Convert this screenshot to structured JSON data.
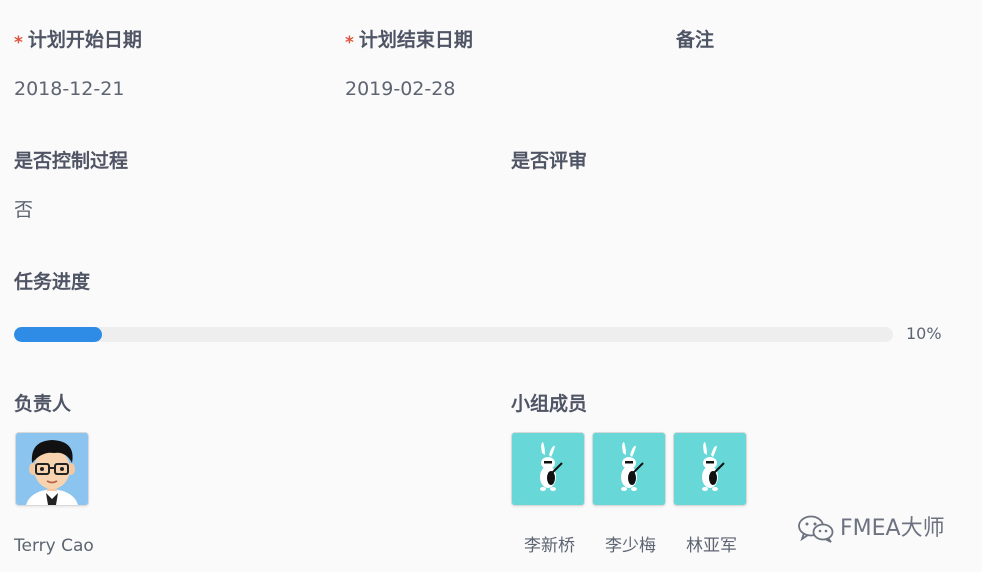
{
  "fields": {
    "plan_start_label": "计划开始日期",
    "plan_start_value": "2018-12-21",
    "plan_end_label": "计划结束日期",
    "plan_end_value": "2019-02-28",
    "remarks_label": "备注",
    "control_process_label": "是否控制过程",
    "control_process_value": "否",
    "review_label": "是否评审",
    "required_marker": "*"
  },
  "progress": {
    "label": "任务进度",
    "percent": 10,
    "text": "10%",
    "color": "#2e8ce6"
  },
  "owner": {
    "label": "负责人",
    "name": "Terry Cao",
    "avatar_icon": "cartoon-boy-avatar"
  },
  "team": {
    "label": "小组成员",
    "avatar_icon": "rabbit-avatar",
    "avatar_bg": "#67d7d7",
    "members": [
      {
        "name": "李新桥"
      },
      {
        "name": "李少梅"
      },
      {
        "name": "林亚军"
      }
    ]
  },
  "watermark": {
    "text": "FMEA大师",
    "icon": "wechat-icon"
  }
}
